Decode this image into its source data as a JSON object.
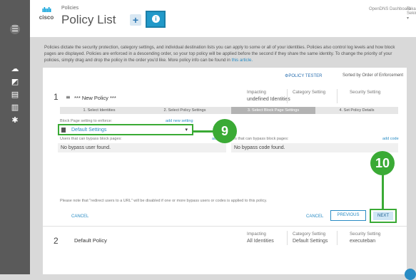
{
  "header": {
    "logo_text": "cisco",
    "breadcrumb": "Policies",
    "title": "Policy List",
    "add_label": "+",
    "info_label": "i",
    "dashboard": "OpenDNS Dashboard",
    "user": "Takashi Sekimon ▾"
  },
  "description": "Policies dictate the security protection, category settings, and individual destination lists you can apply to some or all of your identities.  Policies also control log levels and how block pages are displayed. Policies are enforced in a descending order, so your top policy will be applied before the second if they share the same identity. To change the priority of your policies, simply drag and drop the policy in the order you'd like.  More policy info can be found in",
  "description_link": "this article.",
  "toolbar": {
    "policy_tester": "⚙POLICY TESTER",
    "sort": "Sorted by Order of Enforcement"
  },
  "columns": {
    "impacting": "Impacting",
    "category": "Category Setting",
    "security": "Security Setting"
  },
  "policy1": {
    "number": "1",
    "name": "*** New Policy ***",
    "impacting_value": "undefined Identities",
    "steps": [
      "1. Select Identities",
      "2. Select Policy Settings",
      "3. Select Block Page Settings",
      "4. Set Policy Details"
    ],
    "block_label": "Block Page setting to enforce:",
    "add_setting": "add new setting",
    "dropdown_value": "Default Settings",
    "bypass_users_label": "Users that can bypass block pages:",
    "add_user": "add user",
    "bypass_users_value": "No bypass user found.",
    "bypass_codes_label": "Codes that can bypass block pages:",
    "add_code": "add code",
    "bypass_codes_value": "No bypass code found.",
    "note": "Please note that \"redirect users to a URL\" will be disabled if one or more bypass users or codes is applied to this policy.",
    "cancel": "CANCEL",
    "cancel2": "CANCEL",
    "previous": "PREVIOUS",
    "next": "NEXT"
  },
  "policy2": {
    "number": "2",
    "name": "Default Policy",
    "impacting_value": "All Identities",
    "category_value": "Default Settings",
    "security_value": "executeban"
  },
  "callouts": {
    "nine": "9",
    "ten": "10"
  },
  "colors": {
    "accent": "#2199c9",
    "callout_green": "#3aaa35",
    "sidebar": "#5a5a5a"
  }
}
